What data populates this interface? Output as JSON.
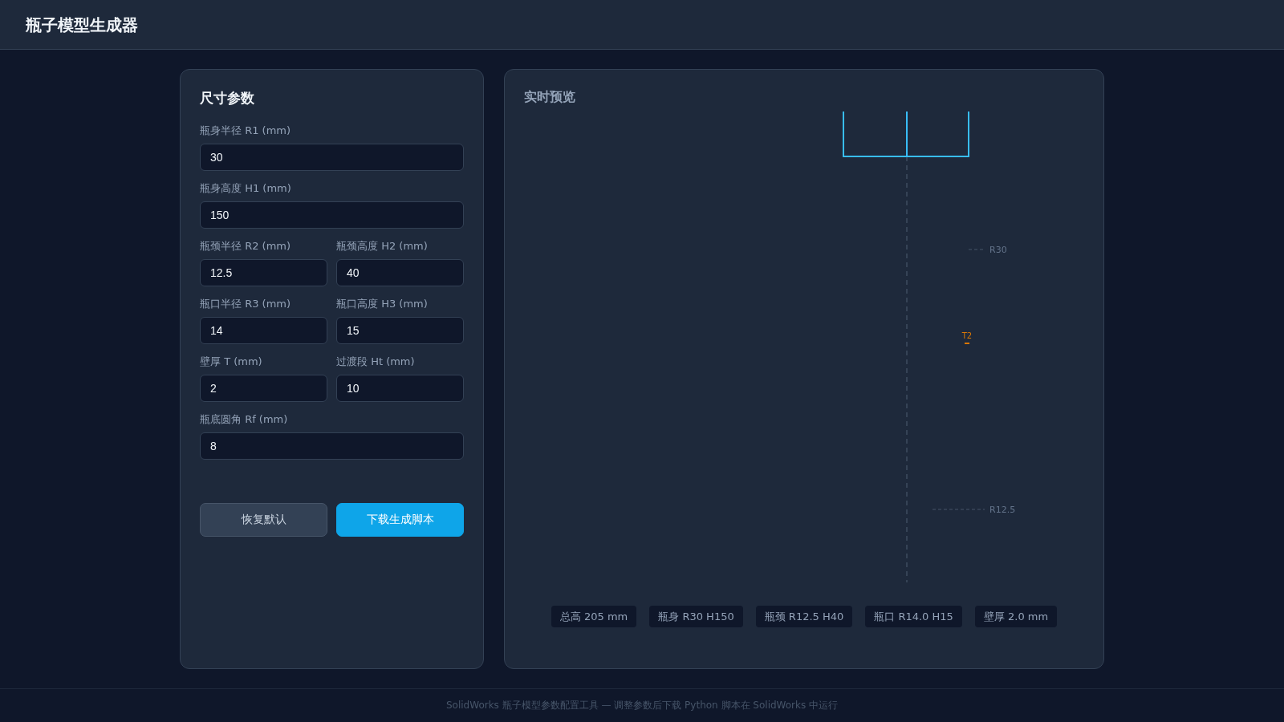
{
  "header": {
    "title": "瓶子模型生成器"
  },
  "params_panel": {
    "title": "尺寸参数",
    "rows": [
      {
        "fields": [
          {
            "label": "瓶身半径 R1 (mm)",
            "value": "30"
          }
        ]
      },
      {
        "fields": [
          {
            "label": "瓶身高度 H1 (mm)",
            "value": "150"
          }
        ]
      },
      {
        "fields": [
          {
            "label": "瓶颈半径 R2 (mm)",
            "value": "12.5"
          },
          {
            "label": "瓶颈高度 H2 (mm)",
            "value": "40"
          }
        ]
      },
      {
        "fields": [
          {
            "label": "瓶口半径 R3 (mm)",
            "value": "14"
          },
          {
            "label": "瓶口高度 H3 (mm)",
            "value": "15"
          }
        ]
      },
      {
        "fields": [
          {
            "label": "壁厚 T (mm)",
            "value": "2"
          },
          {
            "label": "过渡段 Ht (mm)",
            "value": "10"
          }
        ]
      },
      {
        "fields": [
          {
            "label": "瓶底圆角 Rf (mm)",
            "value": "8"
          }
        ]
      }
    ],
    "buttons": [
      {
        "kind": "secondary",
        "label": "恢复默认"
      },
      {
        "kind": "primary",
        "label": "下载生成脚本"
      }
    ]
  },
  "preview_panel": {
    "title": "实时预览",
    "annotations": [
      {
        "kind": "radius",
        "text": "R30"
      },
      {
        "kind": "thickness",
        "text": "T2"
      },
      {
        "kind": "radius",
        "text": "R12.5"
      }
    ],
    "stats": [
      "总高 205 mm",
      "瓶身 R30 H150",
      "瓶颈 R12.5 H40",
      "瓶口 R14.0 H15",
      "壁厚 2.0 mm"
    ]
  },
  "footer": {
    "text": "SolidWorks 瓶子模型参数配置工具 — 调整参数后下载 Python 脚本在 SolidWorks 中运行"
  }
}
